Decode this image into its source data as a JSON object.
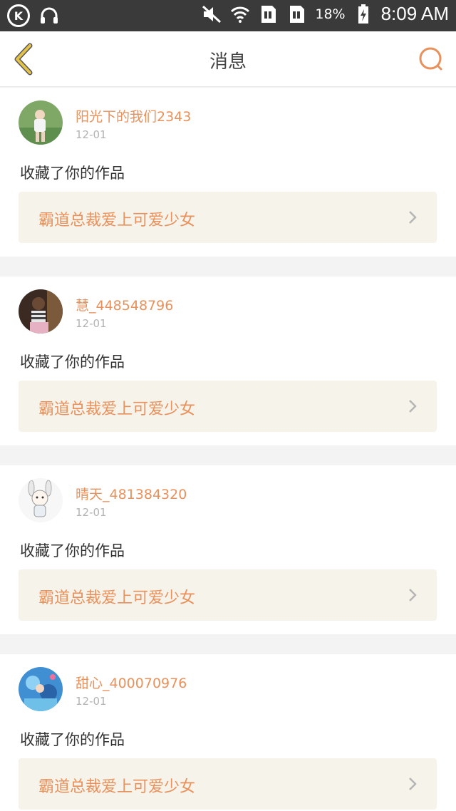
{
  "status_bar": {
    "battery_percent": "18%",
    "time": "8:09 AM",
    "icons": [
      "k-app-icon",
      "headphones-icon",
      "mute-icon",
      "wifi-icon",
      "sim1-icon",
      "sim2-icon",
      "battery-charging-icon"
    ]
  },
  "header": {
    "title": "消息",
    "back_icon": "chevron-left-icon",
    "search_icon": "search-icon"
  },
  "colors": {
    "accent": "#e8915c",
    "back_arrow": "#e3c24a",
    "work_box_bg": "#f6f3ea"
  },
  "messages": [
    {
      "username": "阳光下的我们2343",
      "date": "12-01",
      "action": "收藏了你的作品",
      "work_title": "霸道总裁爱上可爱少女"
    },
    {
      "username": "慧_448548796",
      "date": "12-01",
      "action": "收藏了你的作品",
      "work_title": "霸道总裁爱上可爱少女"
    },
    {
      "username": "晴天_481384320",
      "date": "12-01",
      "action": "收藏了你的作品",
      "work_title": "霸道总裁爱上可爱少女"
    },
    {
      "username": "甜心_400070976",
      "date": "12-01",
      "action": "收藏了你的作品",
      "work_title": "霸道总裁爱上可爱少女"
    }
  ]
}
